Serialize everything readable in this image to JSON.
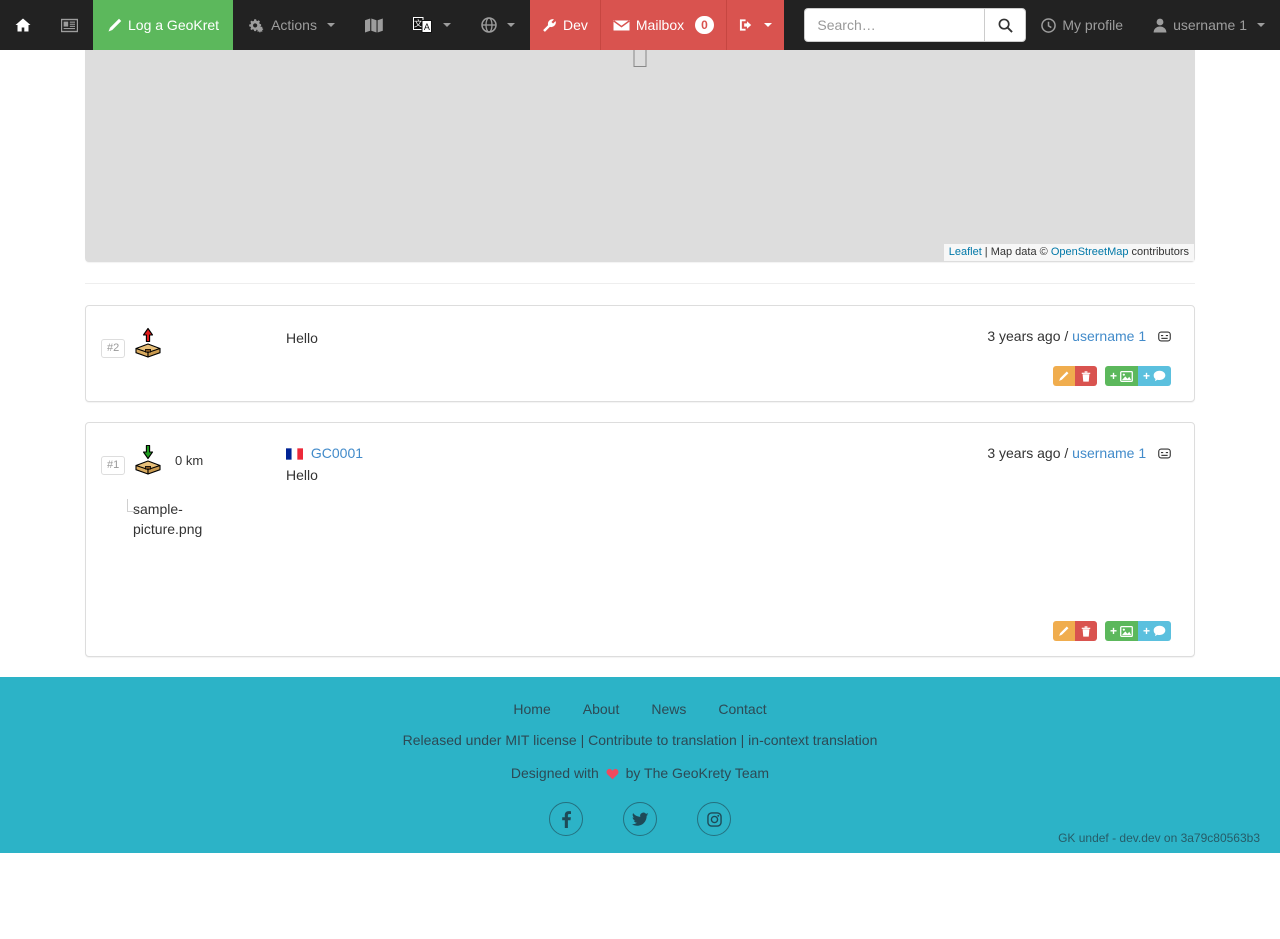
{
  "navbar": {
    "home_label": "Home",
    "news_label": "News",
    "log_label": "Log a GeoKret",
    "actions_label": "Actions",
    "map_label": "Map",
    "language_label": "Language",
    "globe_label": "Region",
    "dev_label": "Dev",
    "mailbox_label": "Mailbox",
    "mailbox_count": "0",
    "login_label": "Login",
    "search_placeholder": "Search…",
    "search_value": "",
    "my_profile_label": "My profile",
    "username_label": "username 1"
  },
  "map": {
    "attrib_leaflet": "Leaflet",
    "attrib_sep": " | Map data © ",
    "attrib_osm": "OpenStreetMap",
    "attrib_tail": " contributors"
  },
  "logs": [
    {
      "number": "#2",
      "type_icon": "box-up-arrow-icon",
      "distance": "",
      "waypoint": "",
      "flag": "",
      "text": "Hello",
      "date": "3 years ago",
      "separator": "/",
      "user": "username 1",
      "mood_icon": "expressionless-face-icon",
      "has_image": false,
      "image_alt": "",
      "buttons": {
        "edit": "edit-log-button",
        "delete": "delete-log-button",
        "add_picture": "add-picture-button",
        "add_comment": "add-comment-button"
      }
    },
    {
      "number": "#1",
      "type_icon": "box-down-arrow-icon",
      "distance": "0 km",
      "waypoint": "GC0001",
      "flag": "france-flag-icon",
      "text": "Hello",
      "date": "3 years ago",
      "separator": "/",
      "user": "username 1",
      "mood_icon": "expressionless-face-icon",
      "has_image": true,
      "image_alt": "sample-picture.png",
      "buttons": {
        "edit": "edit-log-button",
        "delete": "delete-log-button",
        "add_picture": "add-picture-button",
        "add_comment": "add-comment-button"
      }
    }
  ],
  "footer": {
    "nav": [
      "Home",
      "About",
      "News",
      "Contact"
    ],
    "license_pre": "Released under MIT license | ",
    "license_contribute": "Contribute to translation",
    "license_mid": " | ",
    "license_incontext": "in-context translation",
    "designed_pre": "Designed with ",
    "designed_post": " by The GeoKrety Team",
    "social": [
      "facebook-icon",
      "twitter-icon",
      "instagram-icon"
    ],
    "version": "GK undef - dev.dev on 3a79c80563b3"
  },
  "colors": {
    "navbar_bg": "#222222",
    "brand_green": "#5cb85c",
    "danger_red": "#d9534f",
    "footer_teal": "#2cb3c7",
    "link_blue": "#428bca"
  }
}
